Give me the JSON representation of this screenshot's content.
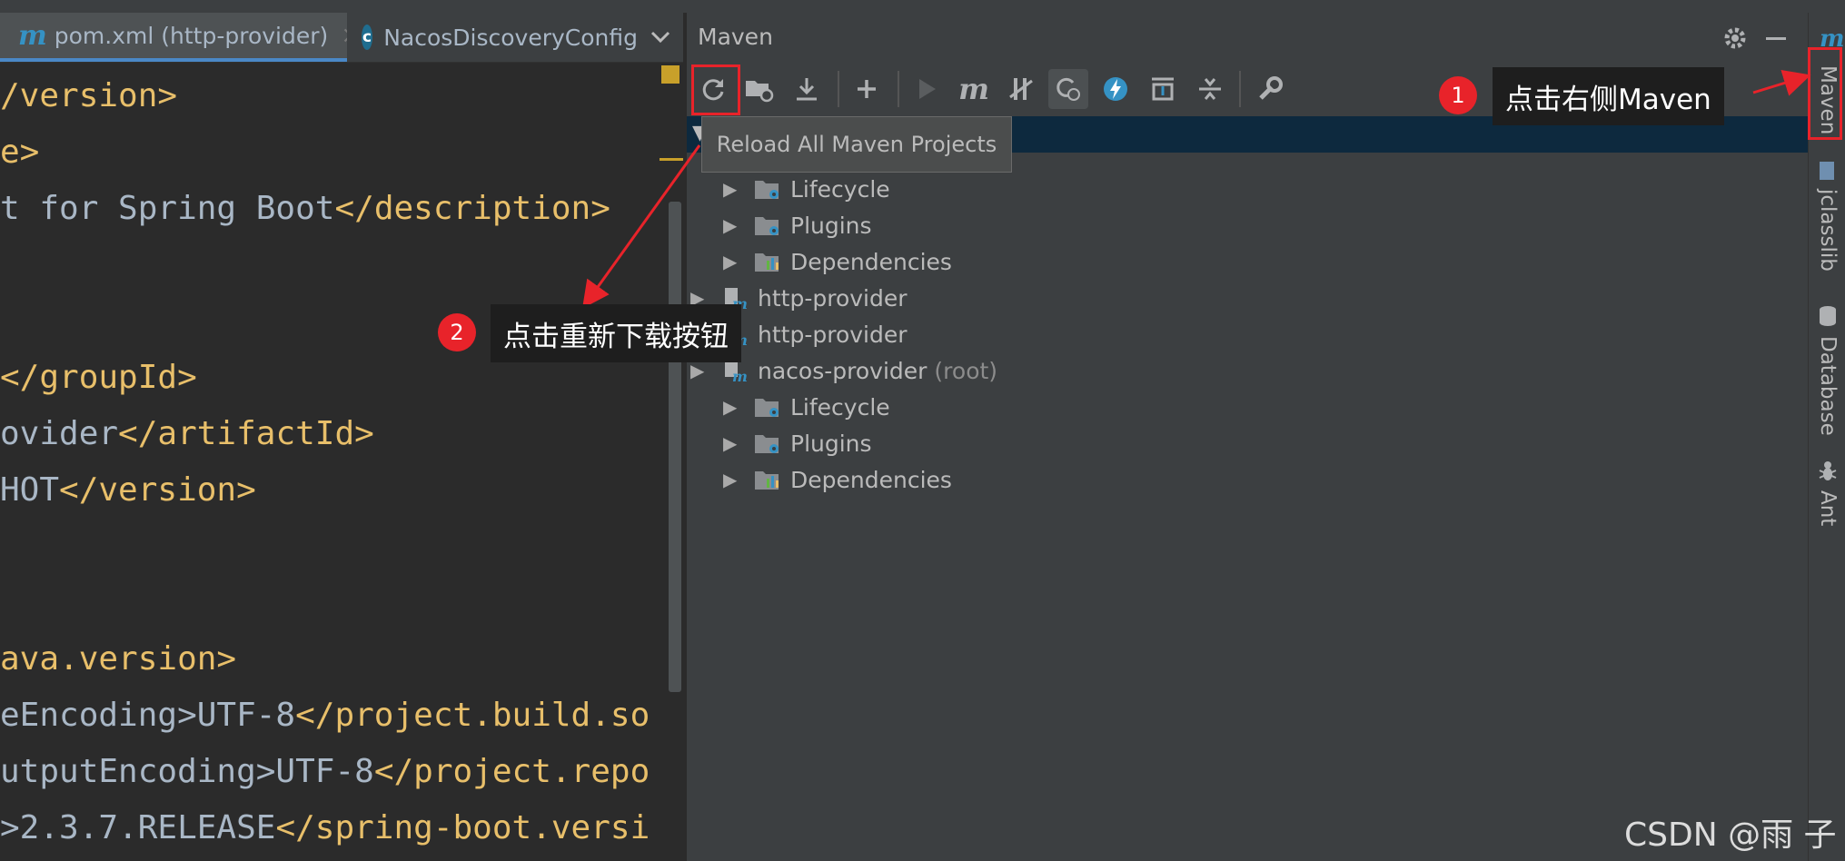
{
  "editor": {
    "tabs": [
      {
        "label": "pom.xml (http-provider)",
        "close": "×",
        "icon_glyph": "m"
      },
      {
        "label": "NacosDiscoveryConfig",
        "icon_glyph": "c"
      }
    ],
    "tab_overflow_icon": "chevron-down-icon",
    "code_lines": [
      {
        "a": "",
        "b": "/version>"
      },
      {
        "a": "",
        "b": "e>"
      },
      {
        "a": "t for Spring Boot",
        "b": "</description>"
      },
      {
        "a": "",
        "b": ""
      },
      {
        "a": "",
        "b": ""
      },
      {
        "a": "",
        "b": "</groupId>"
      },
      {
        "a": "ovider",
        "b": "</artifactId>"
      },
      {
        "a": "HOT",
        "b": "</version>"
      },
      {
        "a": "",
        "b": ""
      },
      {
        "a": "",
        "b": ""
      },
      {
        "a": "",
        "b": "ava.version>"
      },
      {
        "a": "eEncoding>UTF-8",
        "b": "</project.build.so"
      },
      {
        "a": "utputEncoding>UTF-8",
        "b": "</project.repo"
      },
      {
        "a": ">2.3.7.RELEASE",
        "b": "</spring-boot.versi"
      }
    ]
  },
  "maven": {
    "title": "Maven",
    "tooltip": "Reload All Maven Projects",
    "tree": [
      {
        "label": "Lifecycle",
        "level": 2
      },
      {
        "label": "Plugins",
        "level": 2
      },
      {
        "label": "Dependencies",
        "level": 2
      },
      {
        "label": "http-provider",
        "level": 1
      },
      {
        "label": "http-provider",
        "level": 1
      },
      {
        "label": "nacos-provider",
        "suffix": "(root)",
        "level": 1
      },
      {
        "label": "Lifecycle",
        "level": 2
      },
      {
        "label": "Plugins",
        "level": 2
      },
      {
        "label": "Dependencies",
        "level": 2
      }
    ]
  },
  "stripe": {
    "tabs": [
      "Maven",
      "jclasslib",
      "Database",
      "Ant"
    ],
    "top_glyph": "m"
  },
  "callouts": [
    {
      "num": "1",
      "text": "点击右侧Maven"
    },
    {
      "num": "2",
      "text": "点击重新下载按钮"
    }
  ],
  "watermark": "CSDN @雨 子",
  "colors": {
    "accent_red": "#e8232a",
    "tag": "#e8bf6a",
    "selection": "#0d293e"
  }
}
